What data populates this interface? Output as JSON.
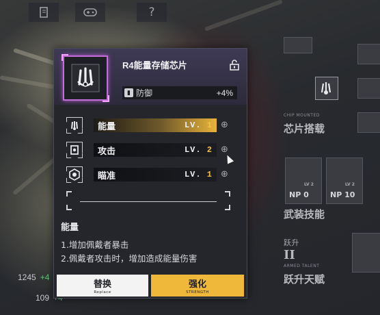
{
  "topbar": {
    "icons": [
      "notebook-icon",
      "gamepad-icon",
      "help-icon"
    ],
    "help_glyph": "?"
  },
  "left_stats": [
    {
      "value": "1245",
      "gain": "+4"
    },
    {
      "value": "109",
      "gain": "+4"
    }
  ],
  "right_panel": {
    "chip_mounted_header": "CHIP MOUNTED",
    "chip_mounted": "芯片搭载",
    "weapon_skill": "武装技能",
    "np_items": [
      {
        "np": "NP",
        "np_value": "0",
        "lv": "LV 2"
      },
      {
        "np": "NP",
        "np_value": "10",
        "lv": "LV 2"
      }
    ],
    "ascend": "跃升",
    "ascend_numeral": "II",
    "armed_talent_header": "ARMED TALENT",
    "ascend_talent": "跃升天赋"
  },
  "chip": {
    "title": "R4能量存储芯片",
    "stat_label": "防御",
    "stat_value": "+4%",
    "rarity_color": "#c36dd8"
  },
  "abilities": [
    {
      "name": "能量",
      "lv_prefix": "LV.",
      "level": "1",
      "active": true
    },
    {
      "name": "攻击",
      "lv_prefix": "LV.",
      "level": "2",
      "active": false
    },
    {
      "name": "瞄准",
      "lv_prefix": "LV.",
      "level": "1",
      "active": false
    }
  ],
  "description": {
    "title": "能量",
    "lines": [
      "1.增加佩戴者暴击",
      "2.佩戴者攻击时，增加造成能量伤害"
    ]
  },
  "buttons": {
    "replace": {
      "label": "替换",
      "sub": "Replace"
    },
    "strength": {
      "label": "强化",
      "sub": "STRENGTH"
    }
  },
  "colors": {
    "accent": "#f0b83a",
    "rarity": "#c36dd8"
  }
}
